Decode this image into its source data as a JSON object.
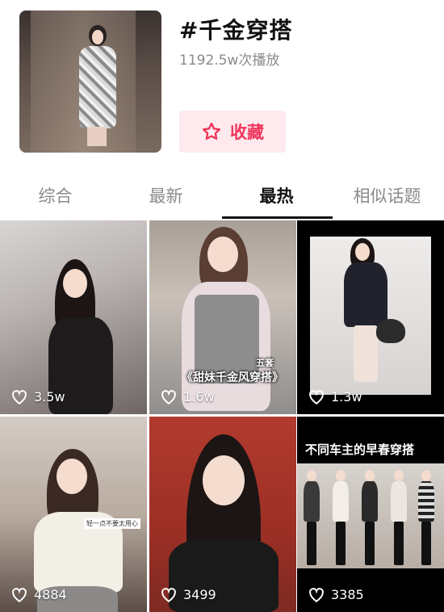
{
  "header": {
    "title": "#千金穿搭",
    "plays": "1192.5w次播放",
    "favorite_label": "收藏"
  },
  "tabs": [
    {
      "label": "综合",
      "active": false
    },
    {
      "label": "最新",
      "active": false
    },
    {
      "label": "最热",
      "active": true
    },
    {
      "label": "相似话题",
      "active": false
    }
  ],
  "videos": [
    {
      "likes": "3.5w"
    },
    {
      "likes": "1.6w",
      "caption_top": "五套",
      "caption": "《甜妹千金风穿搭》"
    },
    {
      "likes": "1.3w"
    },
    {
      "likes": "4884",
      "tag": "轻一点不要太用心"
    },
    {
      "likes": "3499"
    },
    {
      "likes": "3385",
      "banner": "不同车主的早春穿搭"
    }
  ],
  "colors": {
    "accent": "#f0355a",
    "accent_bg": "#fde9ee",
    "tab_active": "#111111",
    "tab_inactive": "#8a8a8a"
  },
  "icons": {
    "favorite": "star-outline-icon",
    "likes": "heart-outline-icon"
  }
}
